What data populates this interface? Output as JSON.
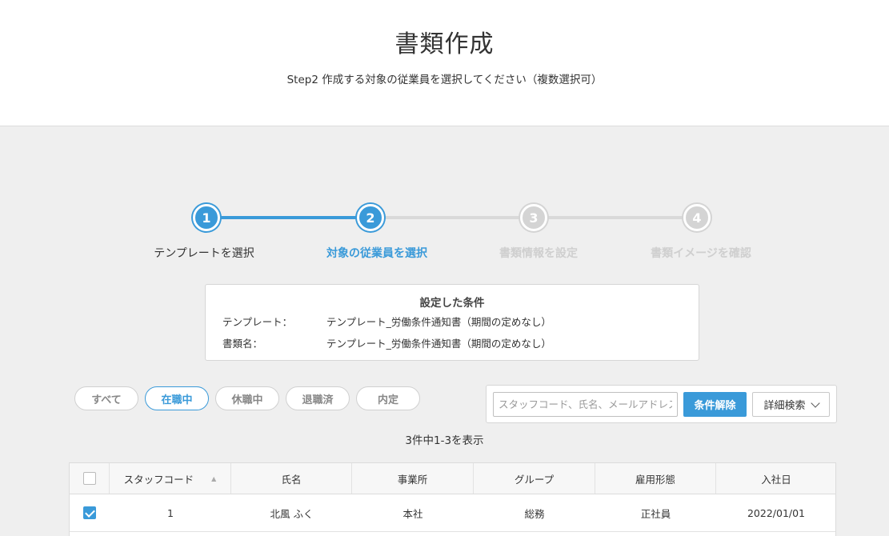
{
  "header": {
    "title": "書類作成",
    "subtitle": "Step2 作成する対象の従業員を選択してください（複数選択可）"
  },
  "stepper": {
    "steps": [
      {
        "number": "1",
        "label": "テンプレートを選択",
        "state": "done"
      },
      {
        "number": "2",
        "label": "対象の従業員を選択",
        "state": "current"
      },
      {
        "number": "3",
        "label": "書類情報を設定",
        "state": "todo"
      },
      {
        "number": "4",
        "label": "書類イメージを確認",
        "state": "todo"
      }
    ]
  },
  "conditions": {
    "title": "設定した条件",
    "template_label": "テンプレート：",
    "template_value": "テンプレート_労働条件通知書（期間の定めなし）",
    "docname_label": "書類名：",
    "docname_value": "テンプレート_労働条件通知書（期間の定めなし）"
  },
  "filters": {
    "pills": [
      {
        "label": "すべて",
        "active": false
      },
      {
        "label": "在職中",
        "active": true
      },
      {
        "label": "休職中",
        "active": false
      },
      {
        "label": "退職済",
        "active": false
      },
      {
        "label": "内定",
        "active": false
      }
    ]
  },
  "search": {
    "placeholder": "スタッフコード、氏名、メールアドレス",
    "value": "",
    "clear_label": "条件解除",
    "detail_label": "詳細検索"
  },
  "result_count": "3件中1-3を表示",
  "table": {
    "headers": [
      "スタッフコード",
      "氏名",
      "事業所",
      "グループ",
      "雇用形態",
      "入社日"
    ],
    "rows": [
      {
        "checked": true,
        "cells": [
          "1",
          "北風 ふく",
          "本社",
          "総務",
          "正社員",
          "2022/01/01"
        ]
      }
    ]
  },
  "colors": {
    "accent": "#3a9ad9",
    "inactive_step": "#d4d4d4",
    "background": "#efefef"
  }
}
